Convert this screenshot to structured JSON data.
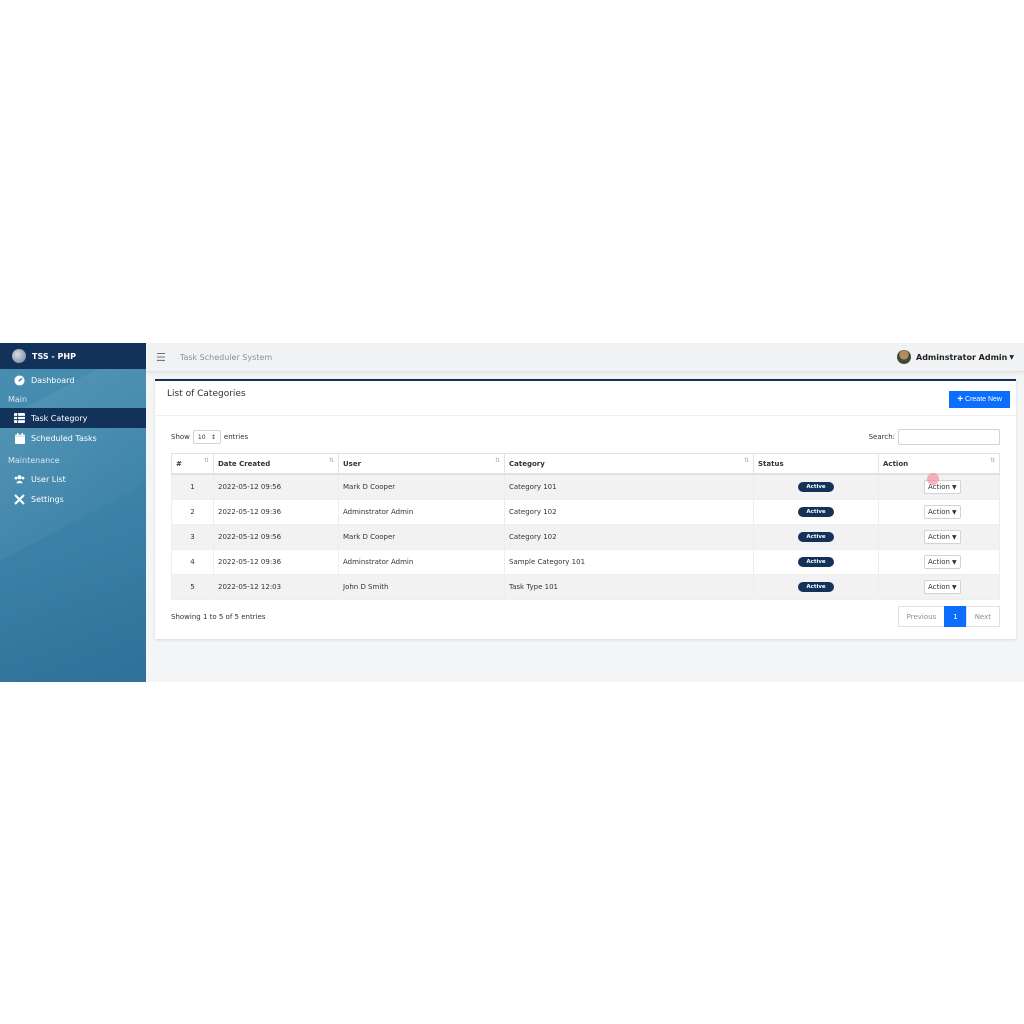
{
  "brand": {
    "title": "TSS - PHP"
  },
  "sidebar": {
    "items": [
      {
        "label": "Dashboard",
        "icon": "dashboard-gauge-icon"
      },
      {
        "header": "Main"
      },
      {
        "label": "Task Category",
        "icon": "table-grid-icon",
        "active": true
      },
      {
        "label": "Scheduled Tasks",
        "icon": "calendar-icon"
      },
      {
        "header": "Maintenance"
      },
      {
        "label": "User List",
        "icon": "users-icon"
      },
      {
        "label": "Settings",
        "icon": "tools-icon"
      }
    ]
  },
  "topbar": {
    "system_name": "Task Scheduler System",
    "user_name": "Adminstrator Admin"
  },
  "card": {
    "title": "List of Categories",
    "create_label": "Create New"
  },
  "table_controls": {
    "show_label": "Show",
    "entries_value": "10",
    "entries_label": "entries",
    "search_label": "Search:"
  },
  "table": {
    "columns": [
      "#",
      "Date Created",
      "User",
      "Category",
      "Status",
      "Action"
    ],
    "rows": [
      {
        "num": "1",
        "date": "2022-05-12 09:56",
        "user": "Mark D Cooper",
        "category": "Category 101",
        "status": "Active",
        "action": "Action"
      },
      {
        "num": "2",
        "date": "2022-05-12 09:36",
        "user": "Adminstrator Admin",
        "category": "Category 102",
        "status": "Active",
        "action": "Action"
      },
      {
        "num": "3",
        "date": "2022-05-12 09:56",
        "user": "Mark D Cooper",
        "category": "Category 102",
        "status": "Active",
        "action": "Action"
      },
      {
        "num": "4",
        "date": "2022-05-12 09:36",
        "user": "Adminstrator Admin",
        "category": "Sample Category 101",
        "status": "Active",
        "action": "Action"
      },
      {
        "num": "5",
        "date": "2022-05-12 12:03",
        "user": "John D Smith",
        "category": "Task Type 101",
        "status": "Active",
        "action": "Action"
      }
    ]
  },
  "footer": {
    "info": "Showing 1 to 5 of 5 entries",
    "previous": "Previous",
    "current_page": "1",
    "next": "Next"
  },
  "colors": {
    "brand_dark": "#13325a",
    "primary": "#0d6efd",
    "sidebar": "#3f86ab"
  }
}
